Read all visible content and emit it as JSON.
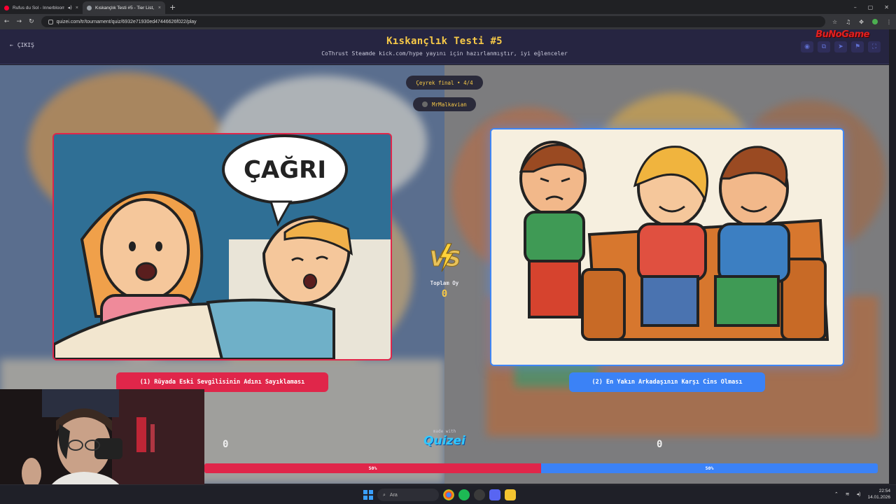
{
  "browser": {
    "tabs": [
      {
        "title": "Rufus du Sol - Innerbloom",
        "active": false,
        "favicon_color": "#ff0033"
      },
      {
        "title": "Kıskançlık Testi #5 - Tier List, K",
        "active": true,
        "favicon_color": "#9aa0a6"
      }
    ],
    "new_tab_icon": "plus-icon",
    "url": "quizei.com/tr/tournament/quiz/6932e71930ed47446626f022/play"
  },
  "header": {
    "exit_label": "ÇIKIŞ",
    "title": "Kıskançlık Testi #5",
    "subtitle": "CoThrust Steamde kick.com/hype yayını için hazırlanmıştır, iyi eğlenceler",
    "brand_logo": "BuNoGame",
    "icons": [
      "eye-icon",
      "copy-icon",
      "share-icon",
      "flag-icon",
      "fullscreen-icon"
    ]
  },
  "match": {
    "round_label": "Çeyrek final • 4/4",
    "username": "MrMalkavian",
    "total_label": "Toplam Oy",
    "total_value": "0",
    "left": {
      "label": "(1) Rüyada Eski Sevgilisinin Adını Sayıklaması",
      "speech_bubble": "ÇAĞRI",
      "votes": "0",
      "percent": 50,
      "percent_label": "50%",
      "color": "#e0264a"
    },
    "right": {
      "label": "(2) En Yakın Arkadaşının Karşı Cins Olması",
      "votes": "0",
      "percent": 50,
      "percent_label": "50%",
      "color": "#3b82f6"
    }
  },
  "footer": {
    "made_with": "made with",
    "logo_text": "Quizei"
  },
  "taskbar": {
    "search_placeholder": "Ara",
    "time": "22:54",
    "date": "14.01.2026"
  }
}
